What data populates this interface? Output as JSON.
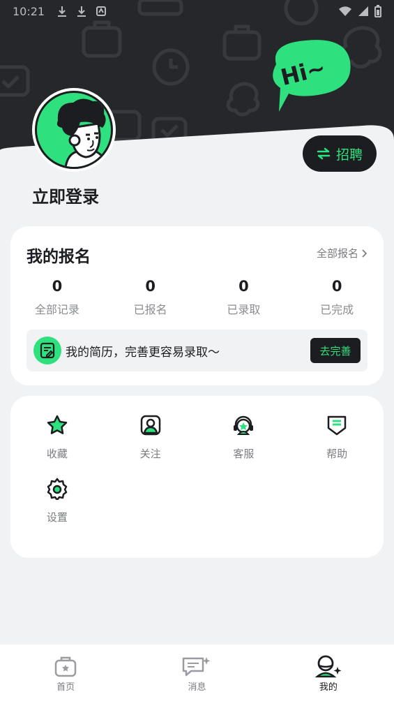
{
  "status_bar": {
    "time": "10:21"
  },
  "profile": {
    "login_text": "立即登录",
    "recruit_label": "招聘",
    "bubble_text": "Hi~"
  },
  "signup": {
    "title": "我的报名",
    "all_link": "全部报名",
    "stats": [
      {
        "value": "0",
        "label": "全部记录"
      },
      {
        "value": "0",
        "label": "已报名"
      },
      {
        "value": "0",
        "label": "已录取"
      },
      {
        "value": "0",
        "label": "已完成"
      }
    ],
    "resume_text": "我的简历，完善更容易录取～",
    "resume_button": "去完善"
  },
  "menu": {
    "items": [
      {
        "label": "收藏",
        "icon": "star-icon"
      },
      {
        "label": "关注",
        "icon": "follow-icon"
      },
      {
        "label": "客服",
        "icon": "customer-service-icon"
      },
      {
        "label": "帮助",
        "icon": "help-icon"
      },
      {
        "label": "设置",
        "icon": "settings-icon"
      }
    ]
  },
  "tabbar": {
    "items": [
      {
        "label": "首页",
        "icon": "home-briefcase-icon"
      },
      {
        "label": "消息",
        "icon": "message-icon"
      },
      {
        "label": "我的",
        "icon": "profile-icon",
        "active": true
      }
    ]
  },
  "colors": {
    "accent": "#2ee07e",
    "dark": "#1c1d21",
    "header_bg": "#26272b",
    "page_bg": "#f1f2f4"
  }
}
